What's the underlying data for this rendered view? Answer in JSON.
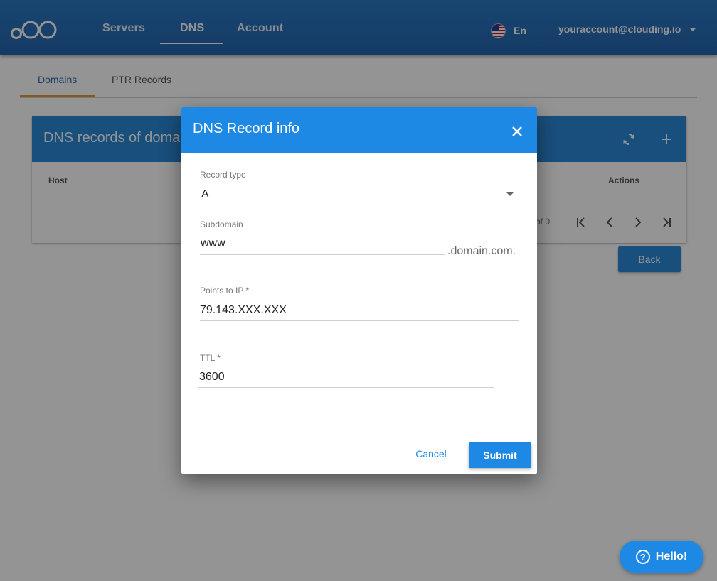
{
  "nav": {
    "items": [
      {
        "label": "Servers"
      },
      {
        "label": "DNS"
      },
      {
        "label": "Account"
      }
    ],
    "active": "DNS",
    "language": "En",
    "account": "youraccount@clouding.io"
  },
  "subtabs": {
    "items": [
      {
        "label": "Domains"
      },
      {
        "label": "PTR Records"
      }
    ],
    "active": "Domains"
  },
  "records_card": {
    "title": "DNS records of doma",
    "columns": {
      "host": "Host",
      "actions": "Actions"
    },
    "pagination_range": "of 0",
    "back_label": "Back"
  },
  "dialog": {
    "title": "DNS Record info",
    "record_type": {
      "label": "Record type",
      "value": "A"
    },
    "subdomain": {
      "label": "Subdomain",
      "value": "www",
      "suffix": ".domain.com."
    },
    "points_to_ip": {
      "label": "Points to IP *",
      "value": "79.143.XXX.XXX"
    },
    "ttl": {
      "label": "TTL *",
      "value": "3600"
    },
    "cancel_label": "Cancel",
    "submit_label": "Submit"
  },
  "help": {
    "label": "Hello!",
    "icon_glyph": "?"
  },
  "colors": {
    "topbar": "#2566ad",
    "header_blue": "#2b88d8",
    "dialog_blue": "#1e88e5",
    "tab_accent": "#e09a36"
  }
}
